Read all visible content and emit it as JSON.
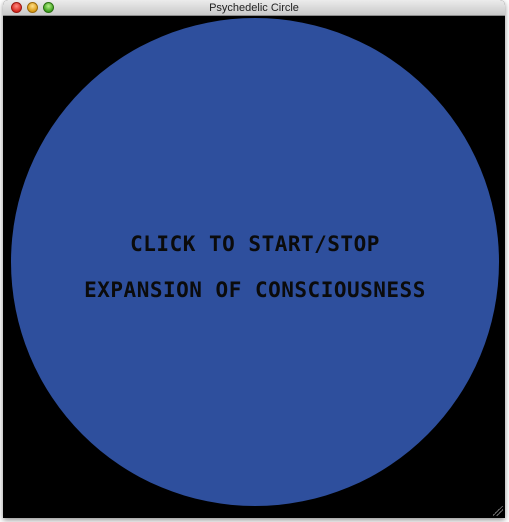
{
  "window": {
    "title": "Psychedelic Circle"
  },
  "circle": {
    "color": "#2e4f9d",
    "line1": "CLICK TO START/STOP",
    "line2": "EXPANSION OF CONSCIOUSNESS"
  }
}
